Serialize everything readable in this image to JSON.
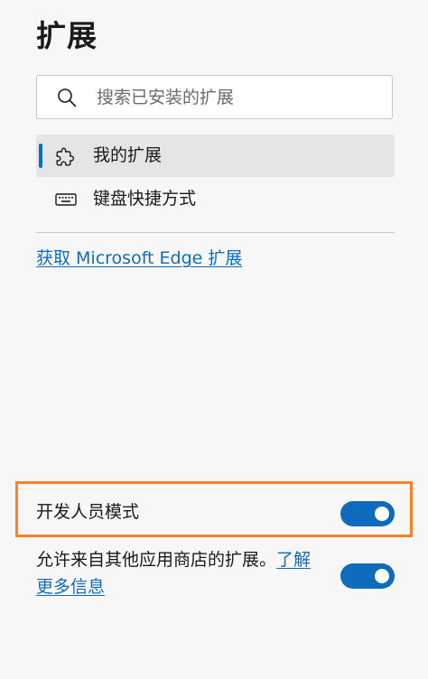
{
  "page": {
    "title": "扩展"
  },
  "search": {
    "placeholder": "搜索已安装的扩展",
    "value": "",
    "icon": "search-icon"
  },
  "nav": {
    "items": [
      {
        "label": "我的扩展",
        "icon": "puzzle-icon",
        "selected": true
      },
      {
        "label": "键盘快捷方式",
        "icon": "keyboard-icon",
        "selected": false
      }
    ]
  },
  "store_link": {
    "label": "获取 Microsoft Edge 扩展"
  },
  "settings": {
    "developer_mode": {
      "label": "开发人员模式",
      "enabled": true,
      "highlight_color": "#ff7f27"
    },
    "other_stores": {
      "label": "允许来自其他应用商店的扩展。",
      "link_label": "了解更多信息",
      "enabled": true
    }
  },
  "colors": {
    "accent": "#0f6cbd",
    "background": "#f7f7f7",
    "selected_background": "#e5e5e5"
  }
}
